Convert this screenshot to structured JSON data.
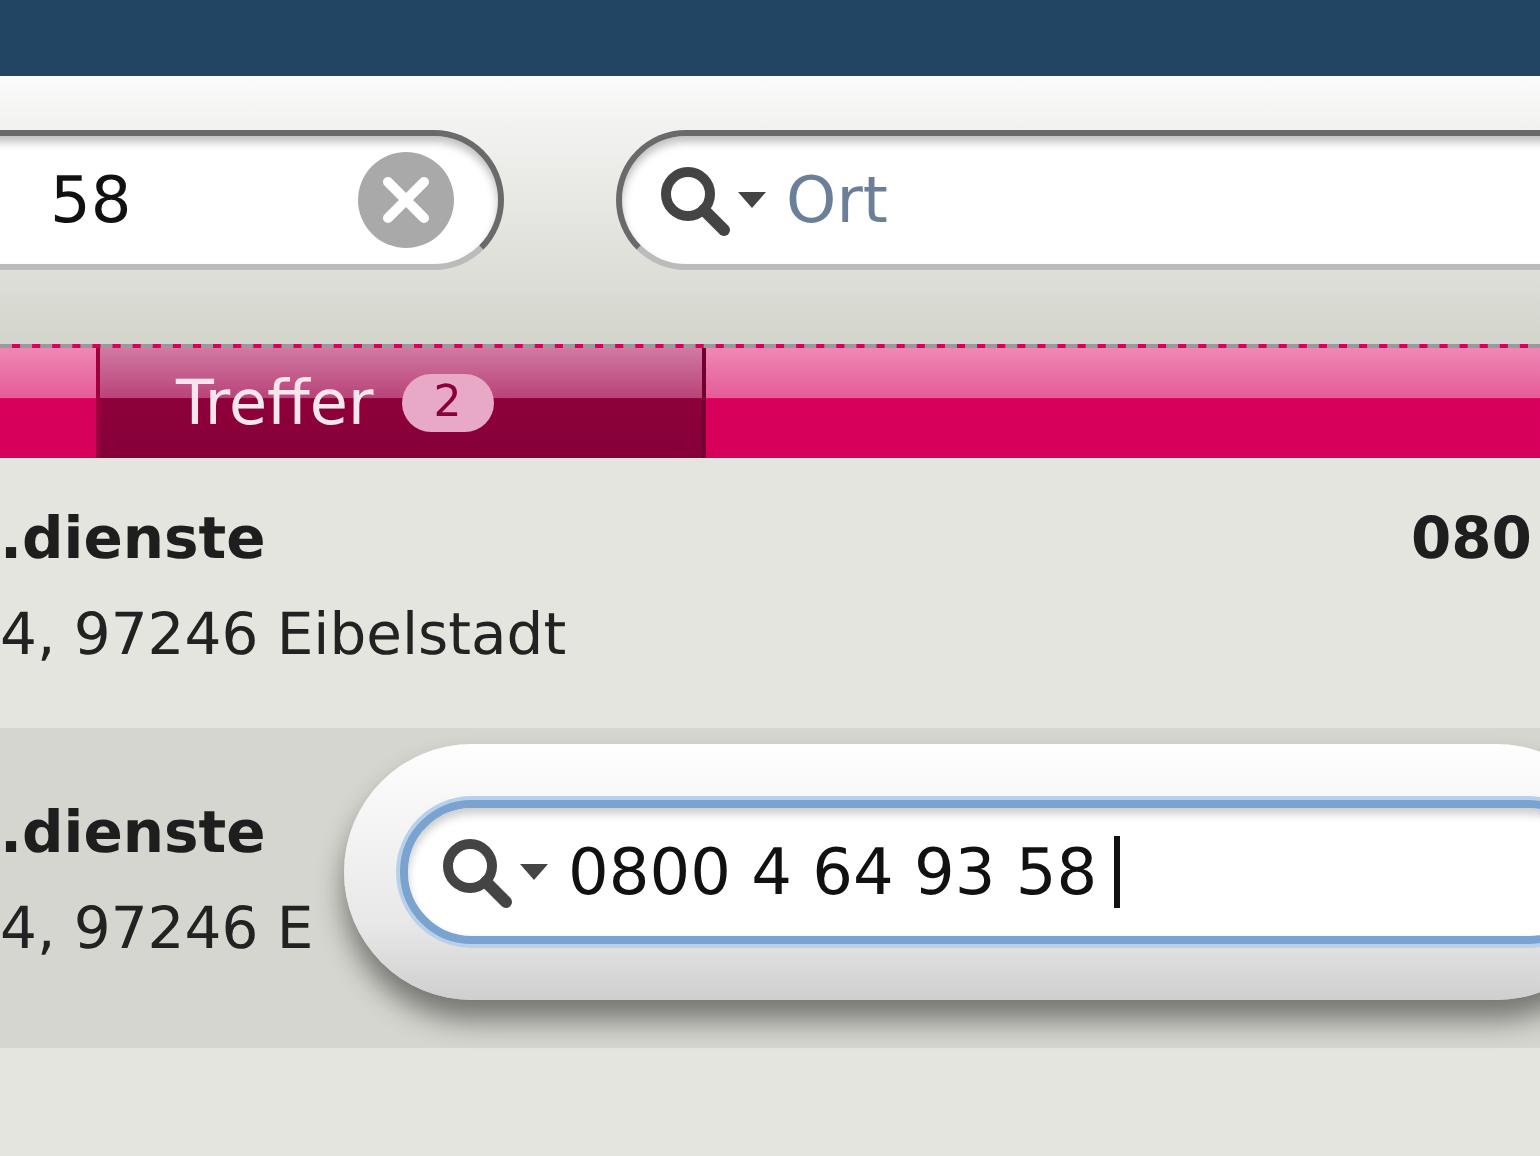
{
  "toolbar": {
    "phone_field": {
      "value": "58"
    },
    "place_field": {
      "placeholder": "Ort"
    }
  },
  "tabs": [
    {
      "label": "Treffer",
      "count": "2",
      "selected": true
    }
  ],
  "results": [
    {
      "name": ".dienste",
      "address": "4, 97246 Eibelstadt",
      "phone": "080",
      "selected": false
    },
    {
      "name": ".dienste",
      "address": "4, 97246 E",
      "selected": true
    }
  ],
  "magnified_field": {
    "value": "0800 4 64 93 58"
  }
}
